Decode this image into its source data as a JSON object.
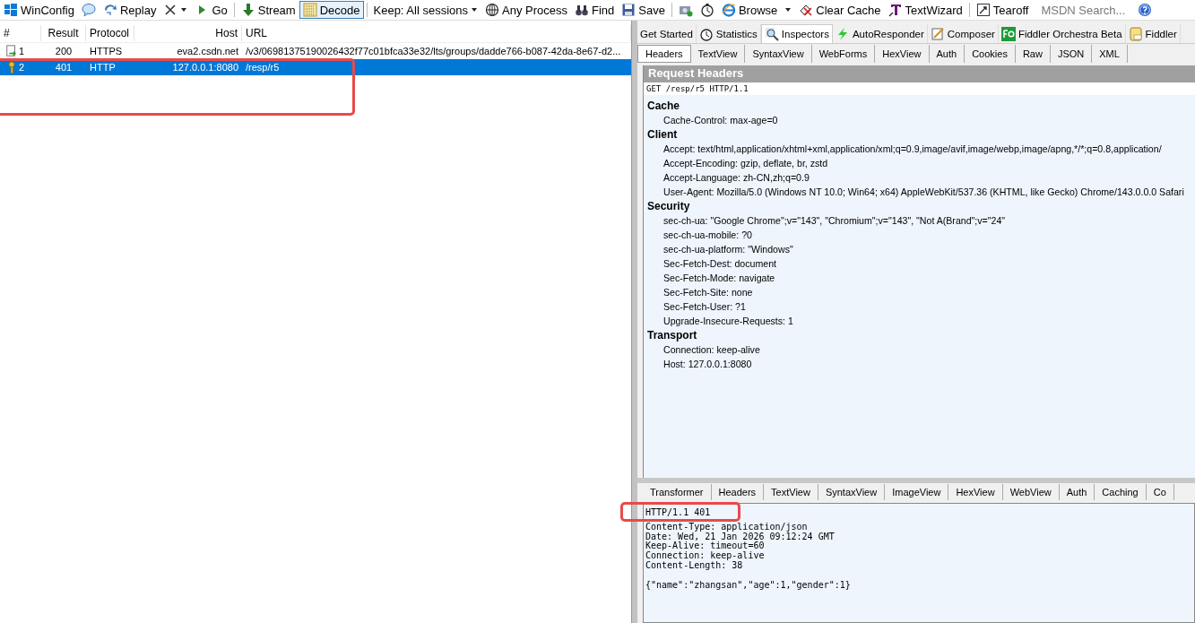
{
  "toolbar": [
    {
      "kind": "button",
      "label": "WinConfig"
    },
    {
      "kind": "icon"
    },
    {
      "kind": "button",
      "label": "Replay"
    },
    {
      "kind": "dropdown"
    },
    {
      "kind": "button",
      "label": "Go"
    },
    {
      "kind": "separator"
    },
    {
      "kind": "button",
      "label": "Stream"
    },
    {
      "kind": "toggle",
      "label": "Decode",
      "on": true
    },
    {
      "kind": "separator"
    },
    {
      "kind": "dropdown",
      "label": "Keep: All sessions"
    },
    {
      "kind": "button",
      "label": "Any Process"
    },
    {
      "kind": "button",
      "label": "Find"
    },
    {
      "kind": "button",
      "label": "Save"
    },
    {
      "kind": "separator"
    },
    {
      "kind": "icon"
    },
    {
      "kind": "icon"
    },
    {
      "kind": "button",
      "label": "Browse"
    },
    {
      "kind": "dropdown"
    },
    {
      "kind": "button",
      "label": "Clear Cache"
    },
    {
      "kind": "button",
      "label": "TextWizard"
    },
    {
      "kind": "separator"
    },
    {
      "kind": "button",
      "label": "Tearoff"
    },
    {
      "kind": "search",
      "placeholder": "MSDN Search..."
    },
    {
      "kind": "icon"
    }
  ],
  "sessions": {
    "columns": [
      "#",
      "Result",
      "Protocol",
      "Host",
      "URL"
    ],
    "rows": [
      {
        "id": "1",
        "result": "200",
        "protocol": "HTTPS",
        "host": "eva2.csdn.net",
        "url": "/v3/06981375190026432f77c01bfca33e32/lts/groups/dadde766-b087-42da-8e67-d2...",
        "selected": false
      },
      {
        "id": "2",
        "result": "401",
        "protocol": "HTTP",
        "host": "127.0.0.1:8080",
        "url": "/resp/r5",
        "selected": true
      }
    ]
  },
  "main_tabs": [
    {
      "label": "Get Started",
      "selected": false
    },
    {
      "label": "Statistics",
      "selected": false
    },
    {
      "label": "Inspectors",
      "selected": true
    },
    {
      "label": "AutoResponder",
      "selected": false
    },
    {
      "label": "Composer",
      "selected": false
    },
    {
      "label": "Fiddler Orchestra Beta",
      "selected": false
    },
    {
      "label": "Fiddler",
      "selected": false
    }
  ],
  "request_tabs": [
    {
      "label": "Headers",
      "selected": true
    },
    {
      "label": "TextView",
      "selected": false
    },
    {
      "label": "SyntaxView",
      "selected": false
    },
    {
      "label": "WebForms",
      "selected": false
    },
    {
      "label": "HexView",
      "selected": false
    },
    {
      "label": "Auth",
      "selected": false
    },
    {
      "label": "Cookies",
      "selected": false
    },
    {
      "label": "Raw",
      "selected": false
    },
    {
      "label": "JSON",
      "selected": false
    },
    {
      "label": "XML",
      "selected": false
    }
  ],
  "request_headers": {
    "title": "Request Headers",
    "request_line": "GET /resp/r5 HTTP/1.1",
    "groups": [
      {
        "name": "Cache",
        "headers": [
          "Cache-Control: max-age=0"
        ]
      },
      {
        "name": "Client",
        "headers": [
          "Accept: text/html,application/xhtml+xml,application/xml;q=0.9,image/avif,image/webp,image/apng,*/*;q=0.8,application/",
          "Accept-Encoding: gzip, deflate, br, zstd",
          "Accept-Language: zh-CN,zh;q=0.9",
          "User-Agent: Mozilla/5.0 (Windows NT 10.0; Win64; x64) AppleWebKit/537.36 (KHTML, like Gecko) Chrome/143.0.0.0 Safari"
        ]
      },
      {
        "name": "Security",
        "headers": [
          "sec-ch-ua: \"Google Chrome\";v=\"143\", \"Chromium\";v=\"143\", \"Not A(Brand\";v=\"24\"",
          "sec-ch-ua-mobile: ?0",
          "sec-ch-ua-platform: \"Windows\"",
          "Sec-Fetch-Dest: document",
          "Sec-Fetch-Mode: navigate",
          "Sec-Fetch-Site: none",
          "Sec-Fetch-User: ?1",
          "Upgrade-Insecure-Requests: 1"
        ]
      },
      {
        "name": "Transport",
        "headers": [
          "Connection: keep-alive",
          "Host: 127.0.0.1:8080"
        ]
      }
    ]
  },
  "response_tabs": [
    {
      "label": "Transformer",
      "selected": false
    },
    {
      "label": "Headers",
      "selected": false
    },
    {
      "label": "TextView",
      "selected": false
    },
    {
      "label": "SyntaxView",
      "selected": false
    },
    {
      "label": "ImageView",
      "selected": false
    },
    {
      "label": "HexView",
      "selected": false
    },
    {
      "label": "WebView",
      "selected": false
    },
    {
      "label": "Auth",
      "selected": false
    },
    {
      "label": "Caching",
      "selected": false
    },
    {
      "label": "Co",
      "selected": false
    }
  ],
  "response_raw": {
    "headers": [
      "HTTP/1.1 401",
      "Content-Type: application/json",
      "Date: Wed, 21 Jan 2026 09:12:24 GMT",
      "Keep-Alive: timeout=60",
      "Connection: keep-alive",
      "Content-Length: 38"
    ],
    "body": "{\"name\":\"zhangsan\",\"age\":1,\"gender\":1}"
  }
}
